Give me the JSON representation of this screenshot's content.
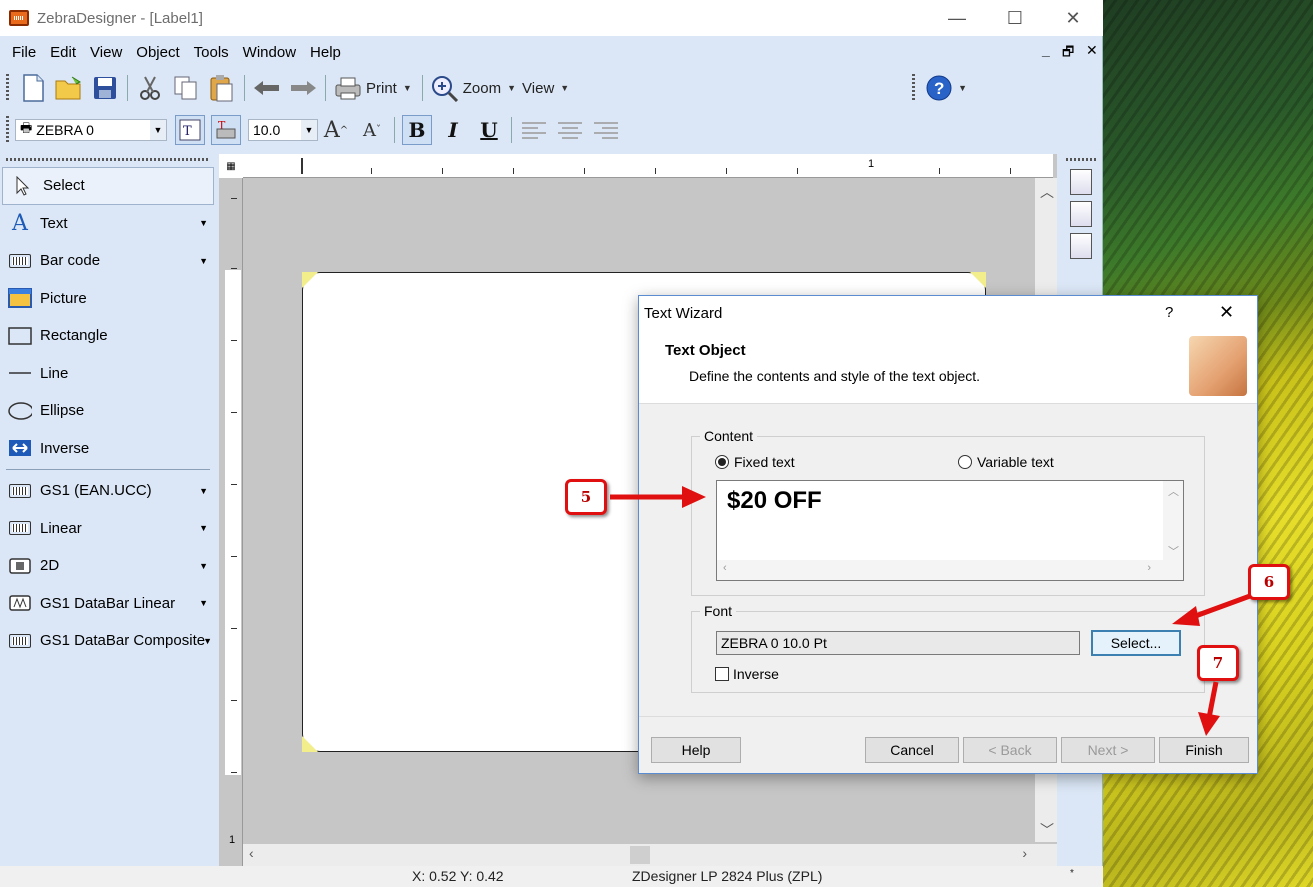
{
  "window": {
    "title": "ZebraDesigner - [Label1]",
    "min": "—",
    "max": "☐",
    "close": "✕"
  },
  "menu": {
    "items": [
      "File",
      "Edit",
      "View",
      "Object",
      "Tools",
      "Window",
      "Help"
    ],
    "mdi_min": "_",
    "mdi_restore": "🗗",
    "mdi_close": "✕"
  },
  "toolbar1": {
    "print_label": "Print",
    "zoom_label": "Zoom",
    "view_label": "View"
  },
  "toolbar2": {
    "font_name": "ZEBRA 0",
    "font_size": "10.0",
    "bold": "B",
    "italic": "I",
    "underline": "U"
  },
  "toolbox": {
    "items": [
      {
        "label": "Select"
      },
      {
        "label": "Text"
      },
      {
        "label": "Bar code"
      },
      {
        "label": "Picture"
      },
      {
        "label": "Rectangle"
      },
      {
        "label": "Line"
      },
      {
        "label": "Ellipse"
      },
      {
        "label": "Inverse"
      },
      {
        "label": "GS1 (EAN.UCC)"
      },
      {
        "label": "Linear"
      },
      {
        "label": "2D"
      },
      {
        "label": "GS1 DataBar Linear"
      },
      {
        "label": "GS1 DataBar Composite"
      }
    ]
  },
  "ruler": {
    "label_1": "1",
    "left_label_1": "1"
  },
  "status": {
    "coords": "X:  0.52 Y:  0.42",
    "printer": "ZDesigner LP 2824 Plus (ZPL)",
    "mark": "*"
  },
  "dialog": {
    "title": "Text Wizard",
    "help_q": "?",
    "close": "✕",
    "heading": "Text Object",
    "subheading": "Define the contents and style of the text object.",
    "content_group": "Content",
    "fixed_text": "Fixed text",
    "variable_text": "Variable text",
    "text_value": "$20 OFF",
    "font_group": "Font",
    "font_value": "ZEBRA 0 10.0 Pt",
    "select_btn": "Select...",
    "inverse_chk": "Inverse",
    "help_btn": "Help",
    "cancel_btn": "Cancel",
    "back_btn": "< Back",
    "next_btn": "Next >",
    "finish_btn": "Finish"
  },
  "callouts": {
    "c5": "5",
    "c6": "6",
    "c7": "7"
  },
  "colors": {
    "accent_red": "#e01010",
    "chrome": "#dbe7f6",
    "dialog_border": "#5b8bd0"
  }
}
